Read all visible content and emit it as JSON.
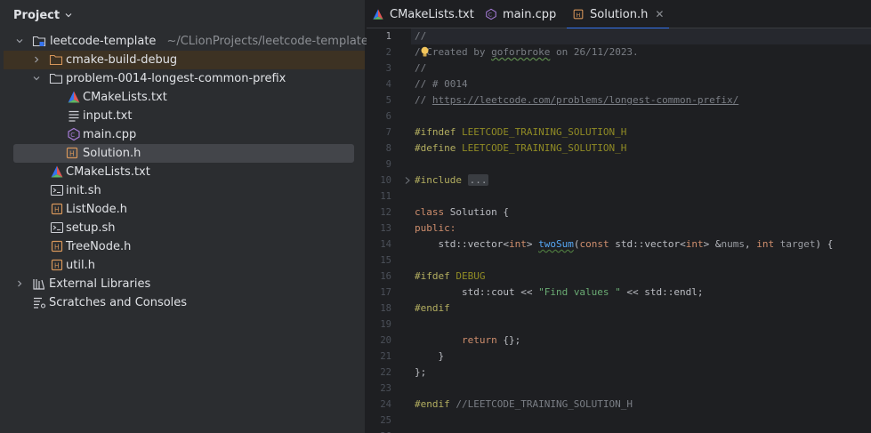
{
  "project_panel": {
    "title": "Project",
    "root": {
      "name": "leetcode-template",
      "path": "~/CLionProjects/leetcode-template"
    },
    "items": [
      {
        "label": "cmake-build-debug"
      },
      {
        "label": "problem-0014-longest-common-prefix"
      },
      {
        "label": "CMakeLists.txt"
      },
      {
        "label": "input.txt"
      },
      {
        "label": "main.cpp"
      },
      {
        "label": "Solution.h"
      },
      {
        "label": "CMakeLists.txt"
      },
      {
        "label": "init.sh"
      },
      {
        "label": "ListNode.h"
      },
      {
        "label": "setup.sh"
      },
      {
        "label": "TreeNode.h"
      },
      {
        "label": "util.h"
      },
      {
        "label": "External Libraries"
      },
      {
        "label": "Scratches and Consoles"
      }
    ]
  },
  "tabs": [
    {
      "label": "CMakeLists.txt"
    },
    {
      "label": "main.cpp"
    },
    {
      "label": "Solution.h",
      "close": "✕"
    }
  ],
  "editor": {
    "line_numbers": [
      "1",
      "2",
      "3",
      "4",
      "5",
      "6",
      "7",
      "8",
      "9",
      "10",
      "11",
      "12",
      "13",
      "14",
      "15",
      "16",
      "17",
      "18",
      "19",
      "20",
      "21",
      "22",
      "23",
      "24",
      "25",
      "26"
    ],
    "code": {
      "l1": "//",
      "l2a": "/",
      "l2b": " Created by ",
      "l2c": "goforbroke",
      "l2d": " on 26/11/2023.",
      "l3": "//",
      "l4": "// # 0014",
      "l5a": "// ",
      "l5b": "https://leetcode.com/problems/longest-common-prefix/",
      "l7a": "#ifndef ",
      "l7b": "LEETCODE_TRAINING_SOLUTION_H",
      "l8a": "#define ",
      "l8b": "LEETCODE_TRAINING_SOLUTION_H",
      "l10a": "#include ",
      "l10b": "...",
      "l13a": "class ",
      "l13b": "Solution {",
      "l14": "public:",
      "l15a": "    std::vector<",
      "l15b": "int",
      "l15c": "> ",
      "l15d": "twoSum",
      "l15e": "(",
      "l15f": "const ",
      "l15g": "std::vector<",
      "l15h": "int",
      "l15i": "> &",
      "l15j": "nums",
      "l15k": ", ",
      "l15l": "int ",
      "l15m": "target",
      "l15n": ") {",
      "l17a": "#ifdef ",
      "l17b": "DEBUG",
      "l18a": "        std::cout << ",
      "l18b": "\"Find values \"",
      "l18c": " << std::endl;",
      "l19": "#endif",
      "l21a": "        ",
      "l21b": "return",
      "l21c": " {};",
      "l22": "    }",
      "l23": "};",
      "l25a": "#endif ",
      "l25b": "//LEETCODE_TRAINING_SOLUTION_H"
    }
  },
  "colors": {
    "background": "#1e1f22",
    "panel": "#2b2d30",
    "accent": "#3574f0",
    "excluded_folder_highlight": "#3d3223",
    "selection": "#43454a"
  },
  "icons": [
    "chevron-down-icon",
    "chevron-right-icon",
    "folder-icon",
    "cmake-icon",
    "text-file-icon",
    "cpp-file-icon",
    "header-file-icon",
    "shell-script-icon",
    "library-icon",
    "scratches-icon",
    "close-icon",
    "lightbulb-icon",
    "fold-icon"
  ]
}
